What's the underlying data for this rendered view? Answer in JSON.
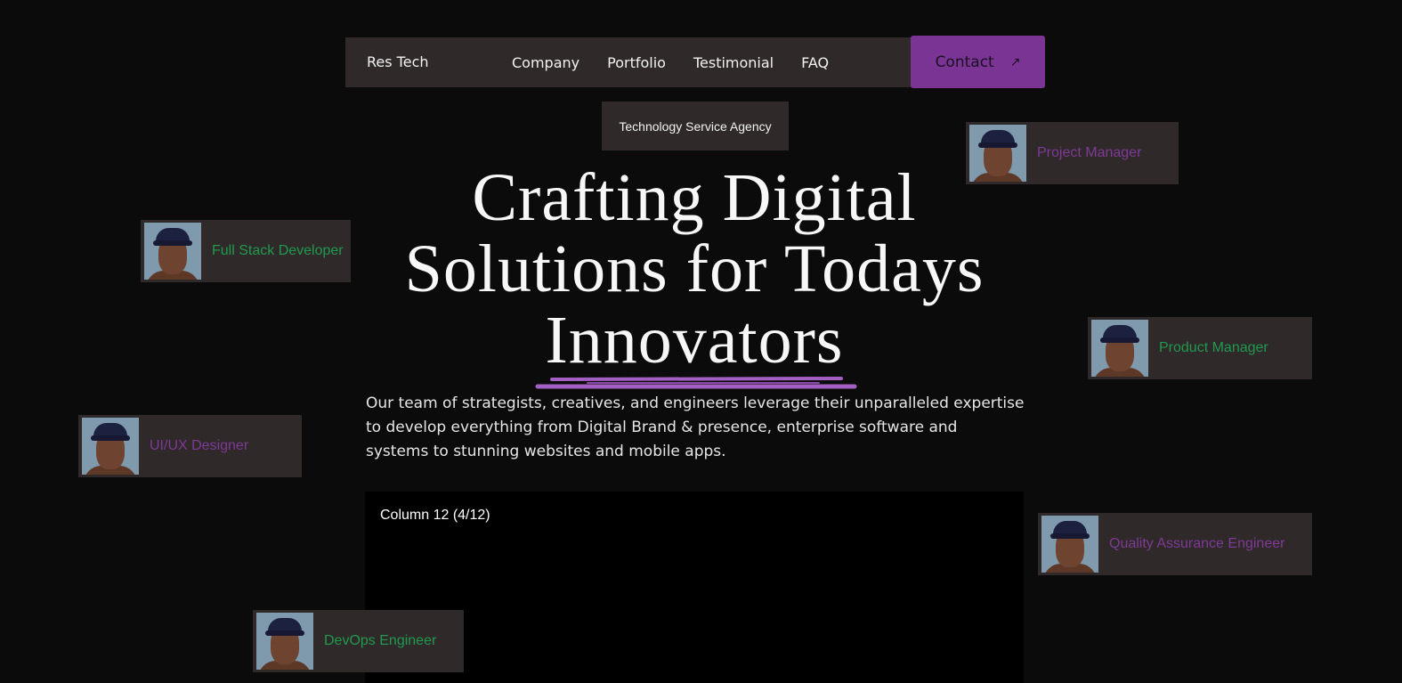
{
  "nav": {
    "brand": "Res Tech",
    "links": [
      "Company",
      "Portfolio",
      "Testimonial",
      "FAQ"
    ],
    "contact_label": "Contact",
    "contact_arrow": "↗"
  },
  "badge": "Technology Service Agency",
  "hero": {
    "title_lines": [
      "Crafting Digital",
      "Solutions for Todays",
      "Innovators"
    ],
    "description": "Our team of strategists, creatives, and engineers leverage their unparalleled expertise to develop everything from Digital Brand & presence, enterprise software and systems to stunning websites and mobile apps."
  },
  "panel": {
    "label": "Column 12 (4/12)"
  },
  "roles": [
    {
      "label": "Project Manager",
      "color": "#7e3a96"
    },
    {
      "label": "Full Stack Developer",
      "color": "#1f9a4e"
    },
    {
      "label": "Product Manager",
      "color": "#1f9a4e"
    },
    {
      "label": "UI/UX Designer",
      "color": "#7e3a96"
    },
    {
      "label": "Quality Assurance Engineer",
      "color": "#7e3a96"
    },
    {
      "label": "DevOps Engineer",
      "color": "#1f9a4e"
    }
  ],
  "colors": {
    "background": "#0b0b0b",
    "card": "#2f2929",
    "accent_purple": "#7a3594",
    "accent_green": "#1f9a4e"
  }
}
